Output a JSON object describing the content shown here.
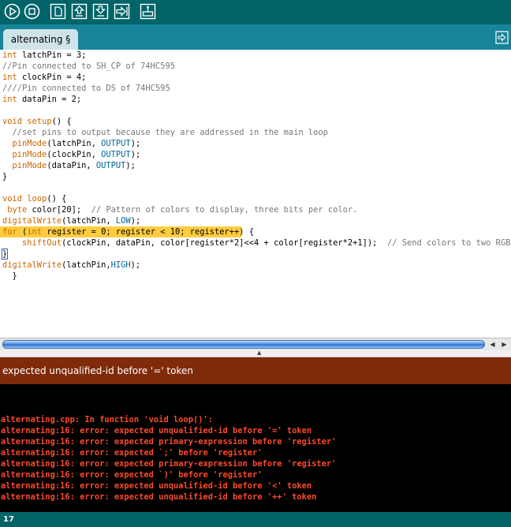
{
  "toolbar": {
    "buttons": [
      {
        "name": "verify",
        "icon": "play-icon"
      },
      {
        "name": "stop",
        "icon": "stop-icon"
      },
      {
        "name": "new",
        "icon": "new-file-icon"
      },
      {
        "name": "open",
        "icon": "upload-arrow-icon"
      },
      {
        "name": "save",
        "icon": "download-arrow-icon"
      },
      {
        "name": "upload",
        "icon": "export-arrow-icon"
      },
      {
        "name": "serial-monitor",
        "icon": "monitor-icon"
      }
    ]
  },
  "tab": {
    "label": "alternating §"
  },
  "editor": {
    "highlight_line": 16,
    "lines": [
      "int latchPin = 3;",
      "//Pin connected to SH_CP of 74HC595",
      "int clockPin = 4;",
      "////Pin connected to DS of 74HC595",
      "int dataPin = 2;",
      "",
      "void setup() {",
      "  //set pins to output because they are addressed in the main loop",
      "  pinMode(latchPin, OUTPUT);",
      "  pinMode(clockPin, OUTPUT);",
      "  pinMode(dataPin, OUTPUT);",
      "}",
      "",
      "void loop() {",
      " byte color[20];  // Pattern of colors to display, three bits per color.",
      "digitalWrite(latchPin, LOW);",
      "for (int register = 0; register < 10; register++) {",
      "    shiftOut(clockPin, dataPin, color[register*2]<<4 + color[register*2+1]);  // Send colors to two RGB LEDs",
      "}",
      "digitalWrite(latchPin,HIGH);",
      "  }"
    ]
  },
  "status": {
    "message": "expected unqualified-id before '=' token"
  },
  "console": {
    "lines": [
      "alternating.cpp: In function 'void loop()':",
      "alternating:16: error: expected unqualified-id before '=' token",
      "alternating:16: error: expected primary-expression before 'register'",
      "alternating:16: error: expected `;' before 'register'",
      "alternating:16: error: expected primary-expression before 'register'",
      "alternating:16: error: expected `)' before 'register'",
      "alternating:16: error: expected unqualified-id before '<' token",
      "alternating:16: error: expected unqualified-id before '++' token"
    ]
  },
  "footer": {
    "line_number": "17"
  },
  "colors": {
    "toolbar": "#006468",
    "tabstrip": "#17849a",
    "status_bg": "#7f2b0a",
    "console_text": "#ff4a2a",
    "highlight": "#ffcc40"
  }
}
